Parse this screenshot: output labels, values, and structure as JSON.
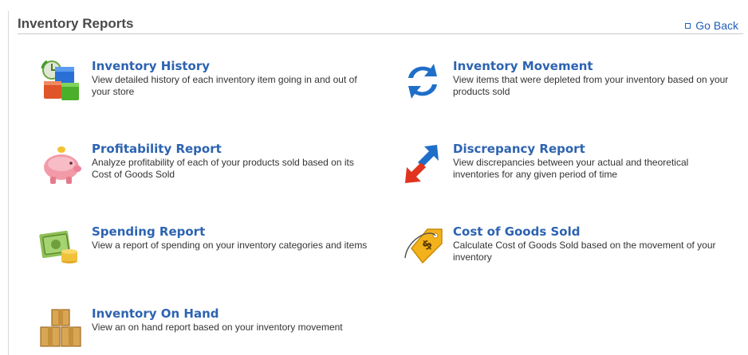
{
  "header": {
    "title": "Inventory Reports",
    "go_back_label": "Go Back"
  },
  "reports": {
    "inventory_history": {
      "title": "Inventory History",
      "description": "View detailed history of each inventory item going in and out of your store",
      "icon": "inventory-history-icon"
    },
    "inventory_movement": {
      "title": "Inventory Movement",
      "description": "View items that were depleted from your inventory based on your products sold",
      "icon": "refresh-arrows-icon"
    },
    "profitability_report": {
      "title": "Profitability Report",
      "description": "Analyze profitability of each of your products sold based on its Cost of Goods Sold",
      "icon": "piggy-bank-icon"
    },
    "discrepancy_report": {
      "title": "Discrepancy Report",
      "description": "View discrepancies between your actual and theoretical inventories for any given period of time",
      "icon": "opposing-arrows-icon"
    },
    "spending_report": {
      "title": "Spending Report",
      "description": "View a report of spending on your inventory categories and items",
      "icon": "money-stack-icon"
    },
    "cost_of_goods_sold": {
      "title": "Cost of Goods Sold",
      "description": "Calculate Cost of Goods Sold based on the movement of your inventory",
      "icon": "price-tag-icon"
    },
    "inventory_on_hand": {
      "title": "Inventory On Hand",
      "description": "View an on hand report based on your inventory movement",
      "icon": "boxes-icon"
    }
  },
  "colors": {
    "link": "#2d63b1",
    "text": "#333333",
    "title": "#4a4a4a"
  }
}
